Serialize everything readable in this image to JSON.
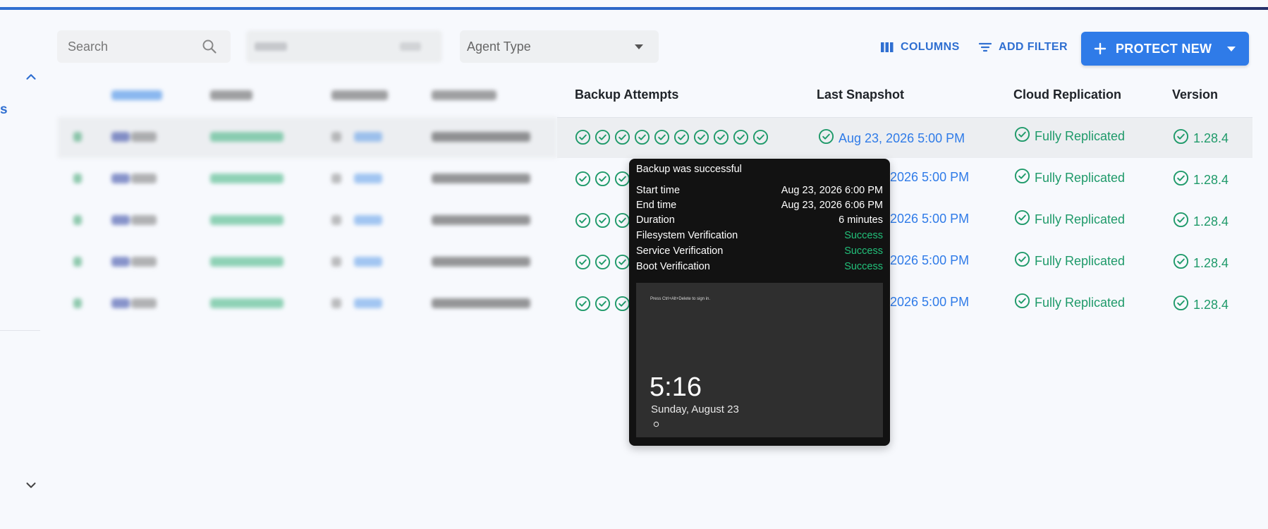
{
  "colors": {
    "accent": "#2f7be8",
    "success": "#1f9a6a",
    "tooltip_bg": "#121212",
    "tooltip_ok": "#22c07a"
  },
  "toolbar": {
    "search_placeholder": "Search",
    "agent_type_label": "Agent Type",
    "columns_label": "COLUMNS",
    "add_filter_label": "ADD FILTER",
    "protect_new_label": "PROTECT NEW"
  },
  "sidebar": {
    "partial_label": "s"
  },
  "table": {
    "headers": {
      "backup_attempts": "Backup Attempts",
      "last_snapshot": "Last Snapshot",
      "cloud_replication": "Cloud Replication",
      "version": "Version"
    },
    "rows": [
      {
        "attempts": 10,
        "snapshot": "Aug 23, 2026 5:00 PM",
        "replication": "Fully Replicated",
        "version": "1.28.4"
      },
      {
        "attempts": 3,
        "snapshot": "2026 5:00 PM",
        "replication": "Fully Replicated",
        "version": "1.28.4"
      },
      {
        "attempts": 3,
        "snapshot": "2026 5:00 PM",
        "replication": "Fully Replicated",
        "version": "1.28.4"
      },
      {
        "attempts": 3,
        "snapshot": "2026 5:00 PM",
        "replication": "Fully Replicated",
        "version": "1.28.4"
      },
      {
        "attempts": 3,
        "snapshot": "2026 5:00 PM",
        "replication": "Fully Replicated",
        "version": "1.28.4"
      }
    ]
  },
  "tooltip": {
    "title": "Backup was successful",
    "rows": [
      {
        "label": "Start time",
        "value": "Aug 23, 2026 6:00 PM",
        "status": false
      },
      {
        "label": "End time",
        "value": "Aug 23, 2026 6:06 PM",
        "status": false
      },
      {
        "label": "Duration",
        "value": "6 minutes",
        "status": false
      },
      {
        "label": "Filesystem Verification",
        "value": "Success",
        "status": true
      },
      {
        "label": "Service Verification",
        "value": "Success",
        "status": true
      },
      {
        "label": "Boot Verification",
        "value": "Success",
        "status": true
      }
    ],
    "screenshot": {
      "hint": "Press Ctrl+Alt+Delete to sign in.",
      "time": "5:16",
      "date": "Sunday, August 23"
    }
  }
}
